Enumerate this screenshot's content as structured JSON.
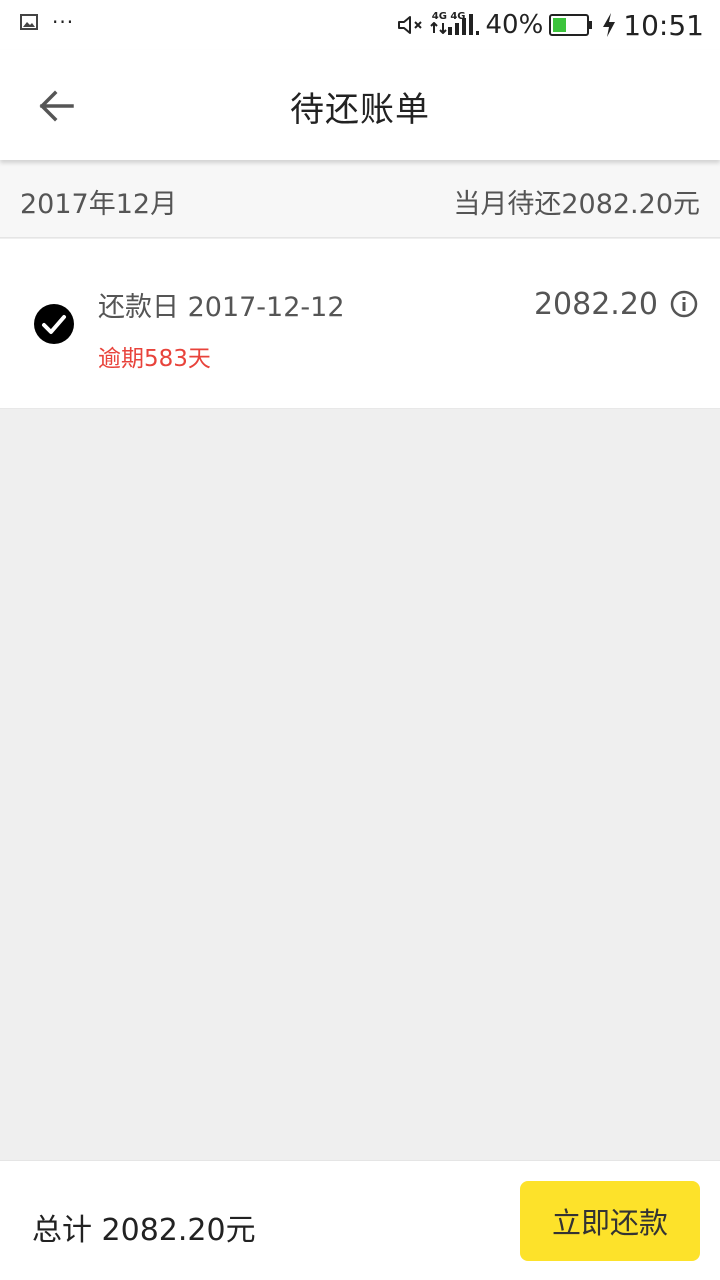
{
  "status_bar": {
    "net_top": "4G",
    "net_top2": "4G",
    "battery_percent": "40%",
    "time": "10:51",
    "icons": [
      "image-icon",
      "more-dots-icon",
      "mute-icon",
      "signal-icon",
      "battery-icon",
      "charging-icon"
    ],
    "battery_color": "#3cc43c"
  },
  "app_bar": {
    "title": "待还账单"
  },
  "month_header": {
    "month": "2017年12月",
    "due_text": "当月待还2082.20元"
  },
  "bill": {
    "due_date": "还款日 2017-12-12",
    "overdue_text": "逾期583天",
    "amount": "2082.20",
    "overdue_color": "#e8433b"
  },
  "bottom_bar": {
    "total_text": "总计 2082.20元",
    "pay_label": "立即还款",
    "pay_color": "#fde22a"
  }
}
